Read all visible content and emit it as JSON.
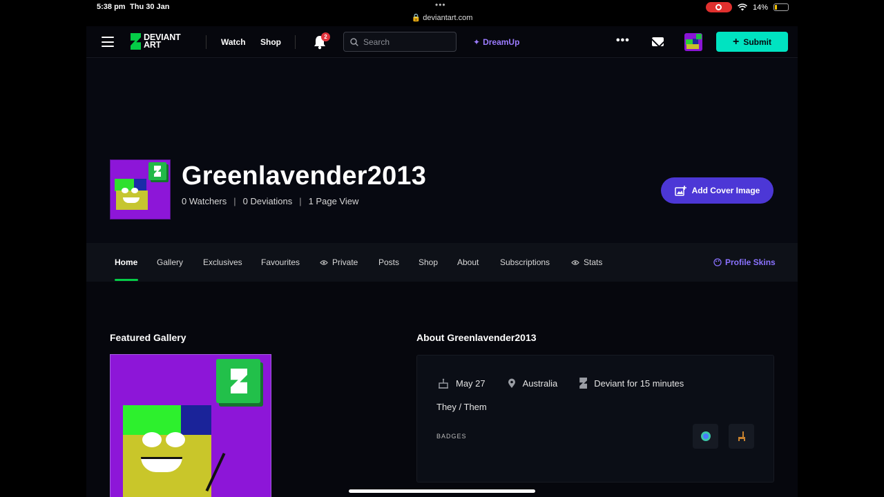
{
  "status_bar": {
    "time": "5:38 pm",
    "date": "Thu 30 Jan",
    "url": "deviantart.com",
    "battery": "14%"
  },
  "nav": {
    "logo_line1": "DEVIANT",
    "logo_line2": "ART",
    "watch": "Watch",
    "shop": "Shop",
    "notification_count": "2",
    "search_placeholder": "Search",
    "dreamup": "DreamUp",
    "more": "•••",
    "submit": "Submit"
  },
  "profile": {
    "username": "Greenlavender2013",
    "watchers": "0 Watchers",
    "deviations": "0 Deviations",
    "page_views": "1 Page View",
    "separator": "|",
    "add_cover": "Add Cover Image"
  },
  "tabs": [
    {
      "label": "Home",
      "active": true
    },
    {
      "label": "Gallery"
    },
    {
      "label": "Exclusives"
    },
    {
      "label": "Favourites"
    },
    {
      "label": "Private"
    },
    {
      "label": "Posts"
    },
    {
      "label": "Shop"
    },
    {
      "label": "About"
    },
    {
      "label": "Subscriptions"
    },
    {
      "label": "Stats"
    }
  ],
  "profile_skins": "Profile Skins",
  "featured": {
    "title": "Featured Gallery"
  },
  "about": {
    "title": "About Greenlavender2013",
    "birthday": "May 27",
    "location": "Australia",
    "deviant_for": "Deviant for 15 minutes",
    "pronouns": "They / Them",
    "badges_label": "BADGES"
  },
  "colors": {
    "accent_green": "#05cc47",
    "submit_teal": "#00e3c1",
    "cover_button": "#4c37d6",
    "avatar_purple": "#8d16d8",
    "link_purple": "#8a72ff"
  }
}
